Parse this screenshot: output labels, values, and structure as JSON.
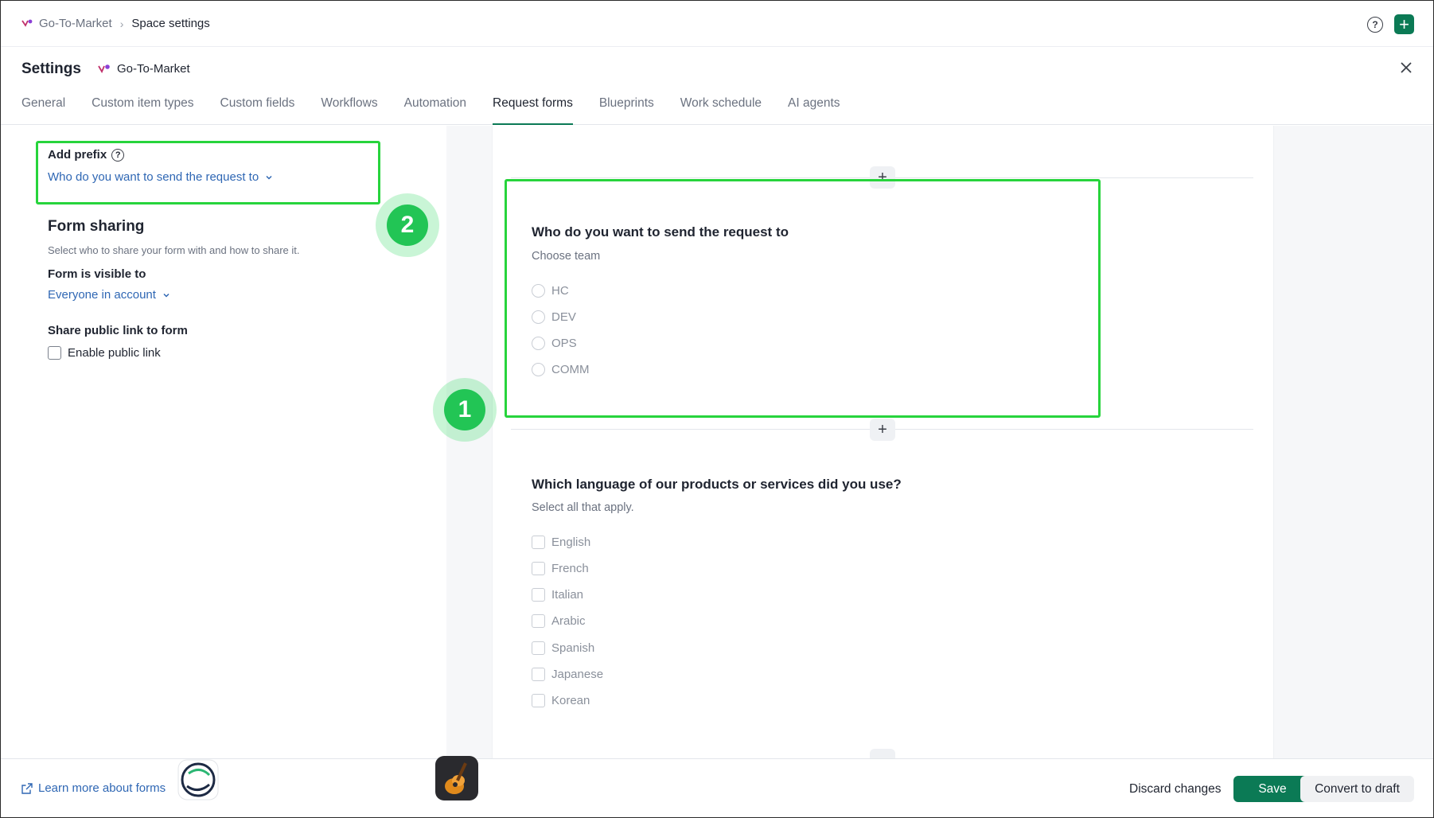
{
  "breadcrumb": {
    "space": "Go-To-Market",
    "current": "Space settings"
  },
  "header": {
    "title": "Settings",
    "space_name": "Go-To-Market"
  },
  "tabs": [
    {
      "label": "General"
    },
    {
      "label": "Custom item types"
    },
    {
      "label": "Custom fields"
    },
    {
      "label": "Workflows"
    },
    {
      "label": "Automation"
    },
    {
      "label": "Request forms",
      "active": true
    },
    {
      "label": "Blueprints"
    },
    {
      "label": "Work schedule"
    },
    {
      "label": "AI agents"
    }
  ],
  "left": {
    "prefix_label": "Add prefix",
    "prefix_value": "Who do you want to send the request to",
    "sharing_title": "Form sharing",
    "sharing_desc": "Select who to share your form with and how to share it.",
    "visible_label": "Form is visible to",
    "visible_value": "Everyone in account",
    "public_label": "Share public link to form",
    "public_checkbox": "Enable public link"
  },
  "badges": {
    "one": "1",
    "two": "2"
  },
  "questions": [
    {
      "title": "Who do you want to send the request to",
      "subtitle": "Choose team",
      "options": [
        "HC",
        "DEV",
        "OPS",
        "COMM"
      ]
    },
    {
      "title": "Which language of our products or services did you use?",
      "subtitle": "Select all that apply.",
      "options": [
        "English",
        "French",
        "Italian",
        "Arabic",
        "Spanish",
        "Japanese",
        "Korean"
      ]
    }
  ],
  "footer": {
    "learn_more": "Learn more about forms",
    "discard": "Discard changes",
    "save": "Save",
    "convert": "Convert to draft"
  },
  "colors": {
    "accent": "#0b7a55",
    "highlight": "#27d43c",
    "link": "#2f67b4"
  }
}
